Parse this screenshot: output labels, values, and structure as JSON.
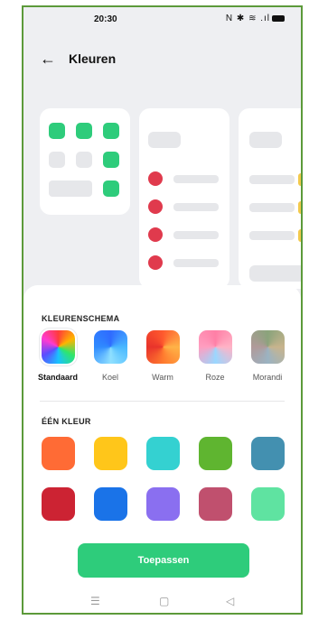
{
  "status": {
    "time": "20:30",
    "icons": "N ✱ ≋ .ıl"
  },
  "header": {
    "title": "Kleuren"
  },
  "section1": {
    "label": "KLEURENSCHEMA"
  },
  "schemes": [
    {
      "label": "Standaard",
      "selected": true
    },
    {
      "label": "Koel"
    },
    {
      "label": "Warm"
    },
    {
      "label": "Roze"
    },
    {
      "label": "Morandi"
    }
  ],
  "section2": {
    "label": "ÉÉN KLEUR"
  },
  "colors": {
    "row1": [
      "#ff6b35",
      "#ffc61a",
      "#34d1d1",
      "#5fb530",
      "#4390b0"
    ],
    "row2": [
      "#cc2333",
      "#1a73e8",
      "#8a6ff0",
      "#c0506e",
      "#5fe3a1"
    ],
    "accent": "#2ecc7b"
  },
  "actions": {
    "apply": "Toepassen"
  },
  "nav": {
    "menu": "☰",
    "home": "▢",
    "back": "◁"
  }
}
